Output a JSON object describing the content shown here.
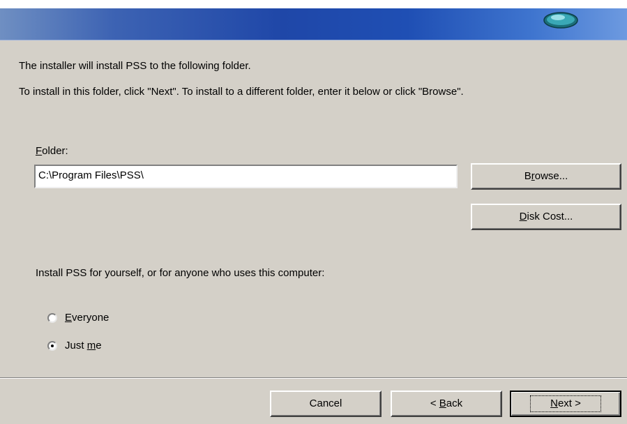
{
  "messages": {
    "line1": "The installer will install PSS to the following folder.",
    "line2": "To install in this folder, click \"Next\". To install to a different folder, enter it below or click \"Browse\"."
  },
  "folder": {
    "label_prefix": "",
    "label_accel": "F",
    "label_rest": "older:",
    "value": "C:\\Program Files\\PSS\\"
  },
  "buttons": {
    "browse_a": "B",
    "browse_accel": "r",
    "browse_b": "owse...",
    "disk_accel": "D",
    "disk_rest": "isk Cost...",
    "cancel": "Cancel",
    "back_a": "< ",
    "back_accel": "B",
    "back_b": "ack",
    "next_accel": "N",
    "next_rest": "ext >"
  },
  "install_for": {
    "question": "Install PSS for yourself, or for anyone who uses this computer:",
    "everyone_accel": "E",
    "everyone_rest": "veryone",
    "justme_a": "Just ",
    "justme_accel": "m",
    "justme_b": "e",
    "selected": "Just me"
  },
  "icons": [
    "globe-icon"
  ]
}
